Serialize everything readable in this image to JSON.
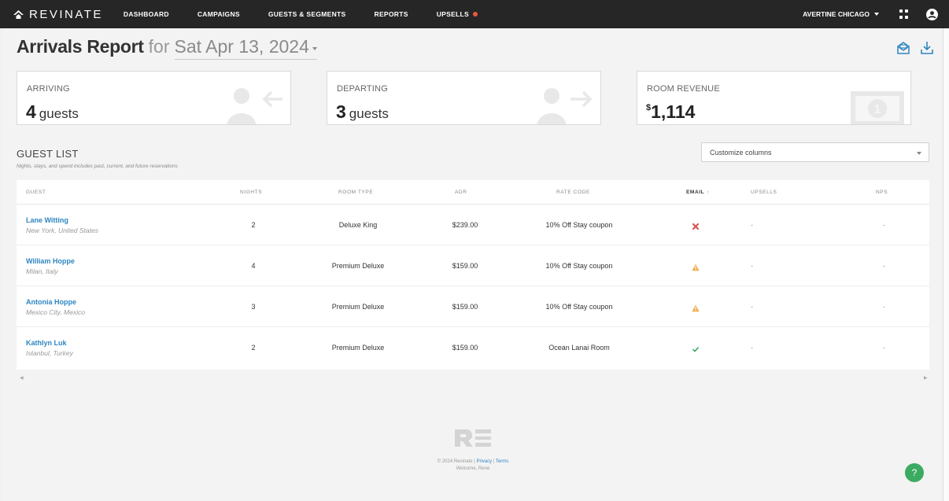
{
  "nav": {
    "brand": "REVINATE",
    "links": [
      "DASHBOARD",
      "CAMPAIGNS",
      "GUESTS & SEGMENTS",
      "REPORTS",
      "UPSELLS"
    ],
    "property": "AVERTINE CHICAGO"
  },
  "header": {
    "title": "Arrivals Report",
    "for": "for",
    "date": "Sat Apr 13, 2024"
  },
  "cards": {
    "arriving": {
      "label": "ARRIVING",
      "value": "4",
      "unit": "guests"
    },
    "departing": {
      "label": "DEPARTING",
      "value": "3",
      "unit": "guests"
    },
    "revenue": {
      "label": "ROOM REVENUE",
      "currency": "$",
      "value": "1,114"
    }
  },
  "guest_list": {
    "title": "GUEST LIST",
    "subtitle": "Nights, stays, and spend includes past, current, and future reservations",
    "customize_label": "Customize columns",
    "columns": [
      "GUEST",
      "NIGHTS",
      "ROOM TYPE",
      "ADR",
      "RATE CODE",
      "EMAIL",
      "UPSELLS",
      "NPS"
    ],
    "sort_arrow": "↑",
    "rows": [
      {
        "name": "Lane Witting",
        "location": "New York, United States",
        "nights": "2",
        "room_type": "Deluxe King",
        "adr": "$239.00",
        "rate_code": "10% Off Stay coupon",
        "email_status": "invalid",
        "upsells": "-",
        "nps": "-"
      },
      {
        "name": "William Hoppe",
        "location": "Milan, Italy",
        "nights": "4",
        "room_type": "Premium Deluxe",
        "adr": "$159.00",
        "rate_code": "10% Off Stay coupon",
        "email_status": "warning",
        "upsells": "-",
        "nps": "-"
      },
      {
        "name": "Antonia Hoppe",
        "location": "Mexico City, Mexico",
        "nights": "3",
        "room_type": "Premium Deluxe",
        "adr": "$159.00",
        "rate_code": "10% Off Stay coupon",
        "email_status": "warning",
        "upsells": "-",
        "nps": "-"
      },
      {
        "name": "Kathlyn Luk",
        "location": "Istanbul, Turkey",
        "nights": "2",
        "room_type": "Premium Deluxe",
        "adr": "$159.00",
        "rate_code": "Ocean Lanai Room",
        "email_status": "valid",
        "upsells": "-",
        "nps": "-"
      }
    ]
  },
  "footer": {
    "copyright": "© 2024 Revinate |",
    "privacy": "Privacy",
    "sep": "|",
    "terms": "Terms",
    "welcome": "Welcome, Rene",
    "help": "?"
  },
  "colors": {
    "nav_bg": "#262626",
    "link": "#2e86c1",
    "invalid": "#d9534f",
    "warning": "#f0ad4e",
    "valid": "#3bab62",
    "upsell_dot": "#e9573f"
  },
  "icons": {
    "brand": "revinate-logo-icon",
    "apps": "apps-grid-icon",
    "user": "user-account-icon",
    "email_report": "email-report-icon",
    "download": "download-icon",
    "arriving": "person-arrow-left-icon",
    "departing": "person-arrow-right-icon",
    "revenue": "banknote-icon"
  }
}
